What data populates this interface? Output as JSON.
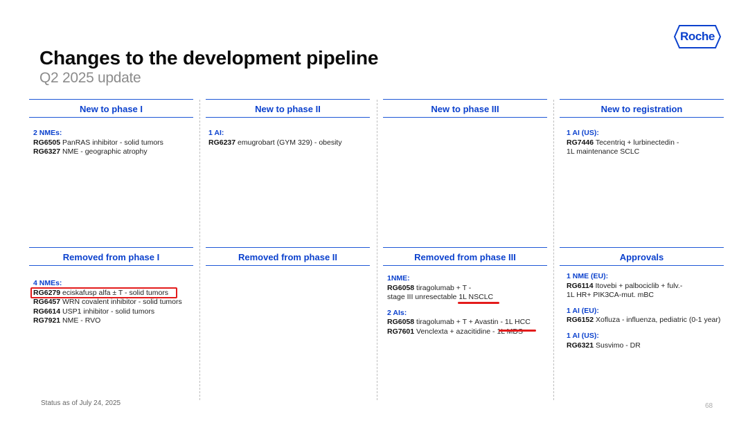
{
  "title": "Changes to the development pipeline",
  "subtitle": "Q2 2025 update",
  "logo": {
    "text": "Roche",
    "color": "#0b41cd"
  },
  "headers": {
    "top": [
      "New to phase I",
      "New to phase II",
      "New to phase III",
      "New to registration"
    ],
    "bottom": [
      "Removed from phase I",
      "Removed from phase II",
      "Removed from phase III",
      "Approvals"
    ]
  },
  "cells": {
    "new_p1": [
      {
        "label": "2 NMEs:",
        "items": [
          {
            "code": "RG6505",
            "text": " PanRAS inhibitor - solid tumors"
          },
          {
            "code": "RG6327",
            "text": " NME -  geographic atrophy"
          }
        ]
      }
    ],
    "new_p2": [
      {
        "label": "1 AI:",
        "items": [
          {
            "code": "RG6237",
            "text": " emugrobart (GYM 329) - obesity"
          }
        ]
      }
    ],
    "new_reg": [
      {
        "label": "1 AI (US):",
        "items": [
          {
            "code": "RG7446",
            "text": " Tecentriq + lurbinectedin -"
          },
          {
            "code": "",
            "text": "1L maintenance SCLC"
          }
        ]
      }
    ],
    "rem_p1": [
      {
        "label": "4 NMEs:",
        "items": [
          {
            "code": "RG6279",
            "text": " eciskafusp alfa ± T - solid tumors"
          },
          {
            "code": "RG6457",
            "text": " WRN covalent inhibitor - solid tumors"
          },
          {
            "code": "RG6614",
            "text": " USP1 inhibitor - solid tumors"
          },
          {
            "code": "RG7921",
            "text": " NME - RVO"
          }
        ]
      }
    ],
    "rem_p3": [
      {
        "label": "1NME:",
        "items": [
          {
            "code": "RG6058",
            "text": " tiragolumab + T -"
          },
          {
            "code": "",
            "text": "stage III unresectable 1L NSCLC"
          }
        ]
      },
      {
        "label": "2 AIs:",
        "items": [
          {
            "code": "RG6058",
            "text": " tiragolumab + T + Avastin - 1L HCC"
          },
          {
            "code": "RG7601",
            "text": " Venclexta + azacitidine - 1L MDS"
          }
        ]
      }
    ],
    "approvals": [
      {
        "label": "1 NME (EU):",
        "items": [
          {
            "code": "RG6114",
            "text": " Itovebi + palbociclib + fulv.-"
          },
          {
            "code": "",
            "text": "1L HR+ PIK3CA-mut. mBC"
          }
        ]
      },
      {
        "label": "1 AI (EU):",
        "items": [
          {
            "code": "RG6152",
            "text": " Xofluza - influenza, pediatric (0-1 year)"
          }
        ]
      },
      {
        "label": "1 AI (US):",
        "items": [
          {
            "code": "RG6321",
            "text": " Susvimo - DR"
          }
        ]
      }
    ]
  },
  "footer": "Status as of July 24, 2025",
  "page_number": "68"
}
